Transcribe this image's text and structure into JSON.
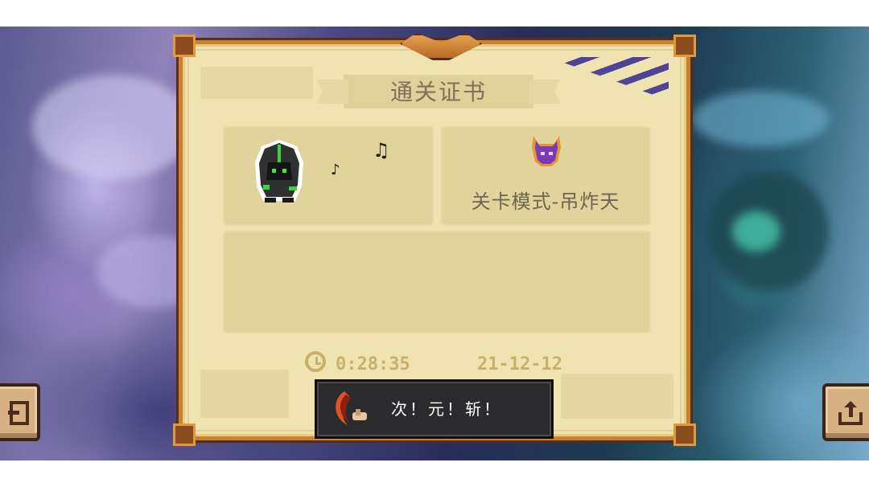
{
  "certificate": {
    "title": "通关证书",
    "character": {
      "icon": "hooded-green-assassin-icon",
      "notes": [
        "♪",
        "♫"
      ]
    },
    "mode": {
      "icon": "purple-horned-demon-icon",
      "label": "关卡模式-吊炸天"
    },
    "time": "0:28:35",
    "date": "21-12-12"
  },
  "toast": {
    "icon": "crescent-blade-icon",
    "text": "次！元！斩！"
  },
  "buttons": {
    "exit_icon": "exit-door-icon",
    "share_icon": "share-upload-icon"
  }
}
